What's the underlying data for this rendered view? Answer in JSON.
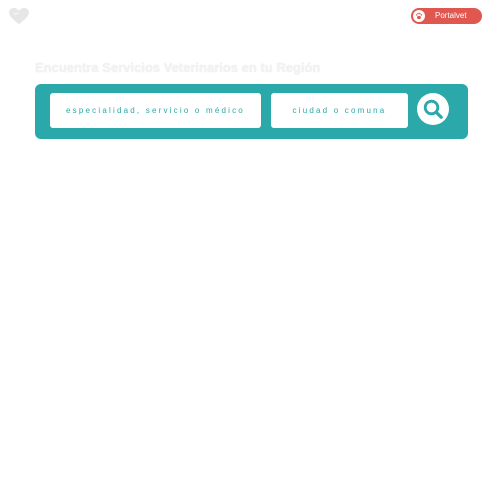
{
  "header": {
    "logo_icon": "heart-icon",
    "portal_button": {
      "label": "Portalvet",
      "icon": "paw-icon",
      "color": "#e0574f"
    }
  },
  "hero": {
    "title": "Encuentra Servicios Veterinarios en tu Región"
  },
  "search": {
    "background_color": "#2aa8aa",
    "specialty_placeholder": "especialidad, servicio o médico",
    "specialty_value": "",
    "city_placeholder": "ciudad o comuna",
    "city_value": "",
    "submit_icon": "search-icon"
  }
}
